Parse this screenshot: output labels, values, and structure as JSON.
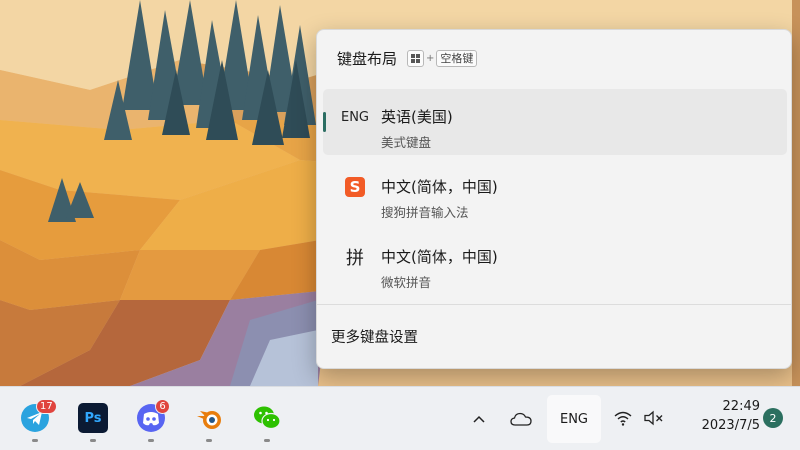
{
  "flyout": {
    "title": "键盘布局",
    "shortcut": {
      "key1_icon": "windows-logo",
      "plus": "+",
      "key2": "空格键"
    },
    "items": [
      {
        "icon_text": "ENG",
        "name": "英语(美国)",
        "desc": "美式键盘",
        "selected": true
      },
      {
        "icon_text": "S",
        "icon": "sogou-logo",
        "name": "中文(简体，中国)",
        "desc": "搜狗拼音输入法",
        "selected": false
      },
      {
        "icon_text": "拼",
        "name": "中文(简体，中国)",
        "desc": "微软拼音",
        "selected": false
      }
    ],
    "more_settings": "更多键盘设置"
  },
  "taskbar": {
    "apps": [
      {
        "name": "telegram",
        "icon": "telegram-icon",
        "badge": "17"
      },
      {
        "name": "photoshop",
        "icon": "photoshop-icon",
        "label": "Ps"
      },
      {
        "name": "discord",
        "icon": "discord-icon",
        "badge": "6"
      },
      {
        "name": "blender",
        "icon": "blender-icon"
      },
      {
        "name": "wechat",
        "icon": "wechat-icon"
      }
    ],
    "tray": {
      "overflow_icon": "chevron-up-icon",
      "onedrive_icon": "cloud-icon",
      "language": "ENG",
      "wifi_icon": "wifi-icon",
      "volume_icon": "speaker-muted-icon",
      "time": "22:49",
      "date": "2023/7/5",
      "notifications": "2"
    }
  },
  "colors": {
    "accent": "#2c6e63",
    "flyout_bg": "#f3f3f3",
    "taskbar_bg": "#eef0f3",
    "sogou": "#f25b26",
    "badge": "#e0443e"
  }
}
